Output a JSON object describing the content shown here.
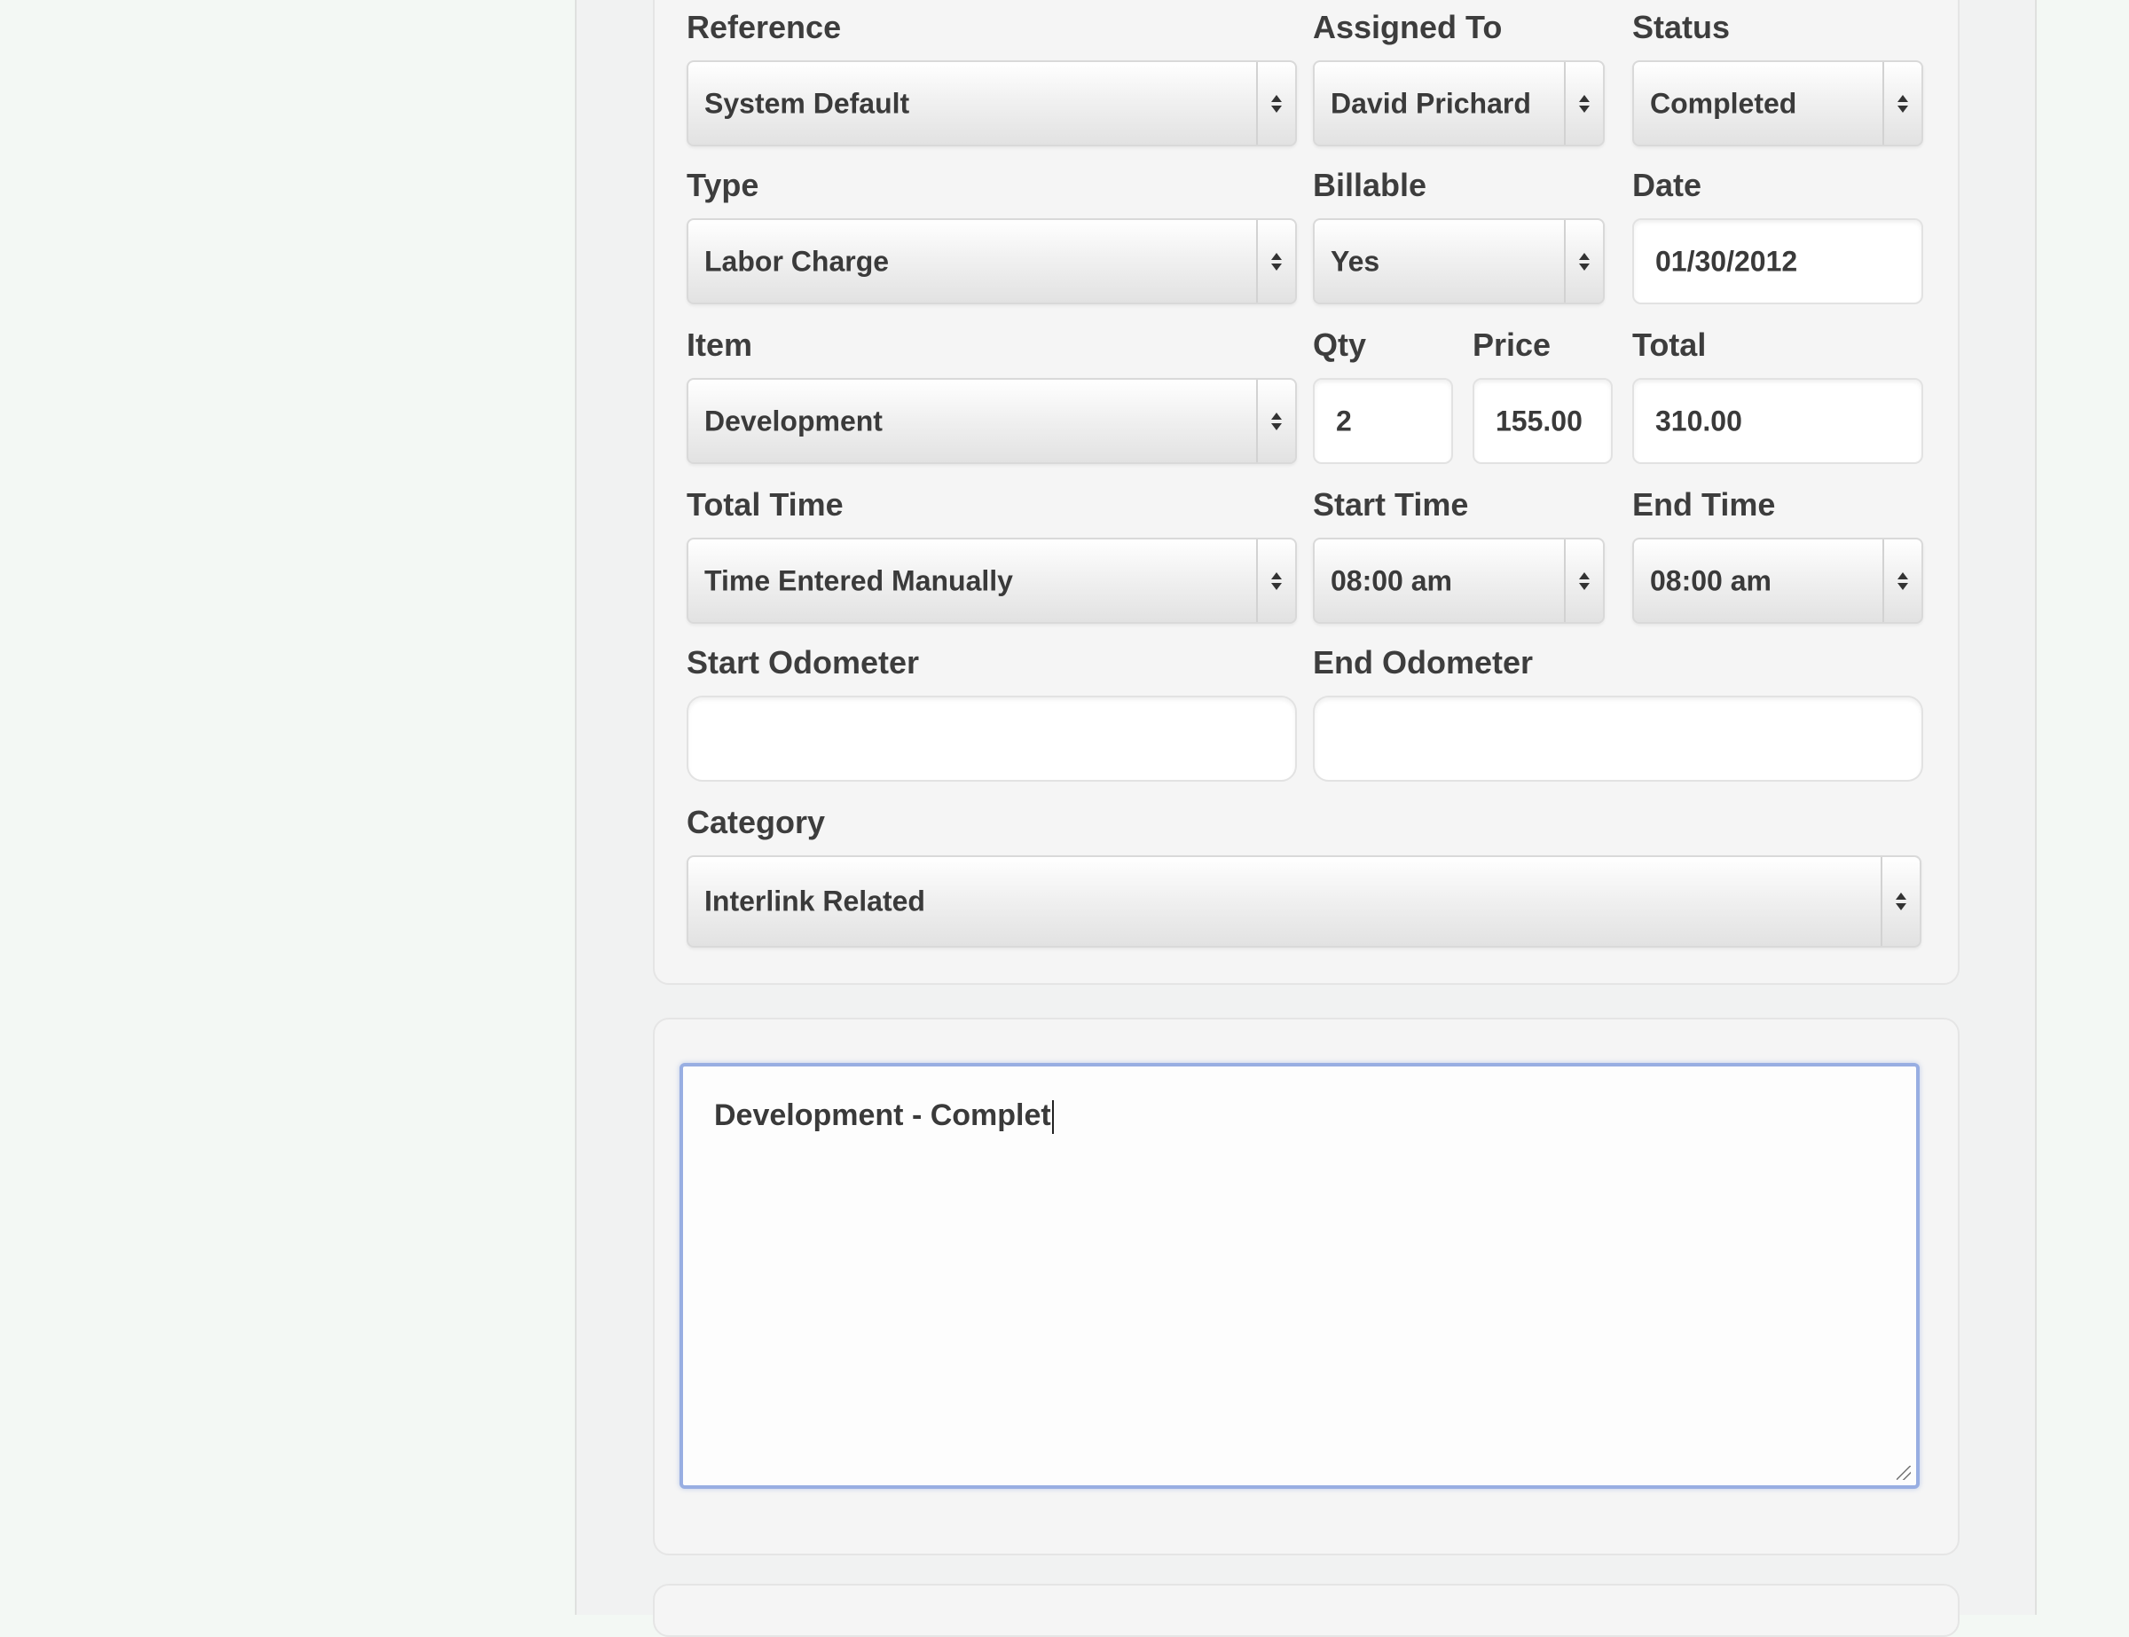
{
  "form": {
    "reference": {
      "label": "Reference",
      "value": "System Default"
    },
    "assigned_to": {
      "label": "Assigned To",
      "value": "David Prichard"
    },
    "status": {
      "label": "Status",
      "value": "Completed"
    },
    "type": {
      "label": "Type",
      "value": "Labor Charge"
    },
    "billable": {
      "label": "Billable",
      "value": "Yes"
    },
    "date": {
      "label": "Date",
      "value": "01/30/2012"
    },
    "item": {
      "label": "Item",
      "value": "Development"
    },
    "qty": {
      "label": "Qty",
      "value": "2"
    },
    "price": {
      "label": "Price",
      "value": "155.00"
    },
    "total": {
      "label": "Total",
      "value": "310.00"
    },
    "total_time": {
      "label": "Total Time",
      "value": "Time Entered Manually"
    },
    "start_time": {
      "label": "Start Time",
      "value": "08:00 am"
    },
    "end_time": {
      "label": "End Time",
      "value": "08:00 am"
    },
    "start_odometer": {
      "label": "Start Odometer",
      "value": ""
    },
    "end_odometer": {
      "label": "End Odometer",
      "value": ""
    },
    "category": {
      "label": "Category",
      "value": "Interlink Related"
    }
  },
  "notes": {
    "value": "Development - Complet"
  },
  "colors": {
    "focus_border": "#98aee2",
    "page_background": "#f3f8f4",
    "panel_background": "#f1f2f2"
  }
}
